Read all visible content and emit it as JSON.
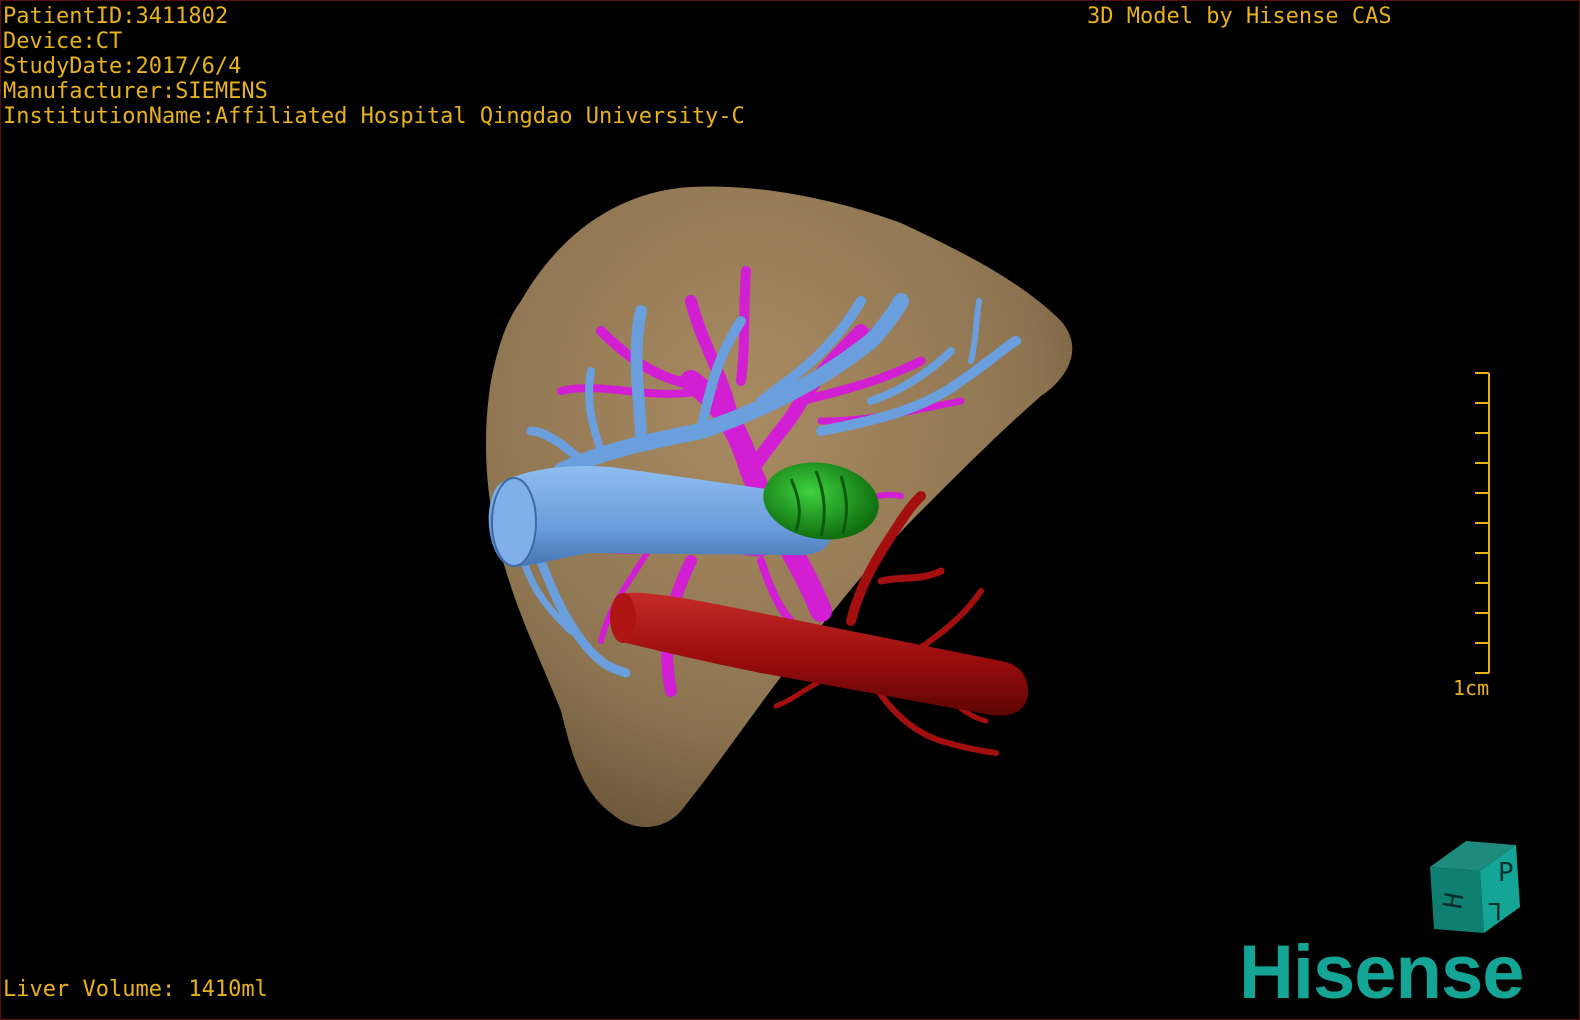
{
  "header": {
    "patient_id": "PatientID:3411802",
    "device": "Device:CT",
    "study_date": "StudyDate:2017/6/4",
    "manufacturer": "Manufacturer:SIEMENS",
    "institution": "InstitutionName:Affiliated Hospital Qingdao University-C"
  },
  "watermark": "3D Model by Hisense CAS",
  "footer": {
    "volume": "Liver Volume: 1410ml"
  },
  "scale": {
    "label": "1cm",
    "ticks": 10
  },
  "orientation_cube": {
    "faces": [
      "P",
      "H",
      "L"
    ]
  },
  "brand": {
    "name": "Hisense",
    "color": "#14a597"
  },
  "colors": {
    "overlay_text": "#e8b21c",
    "liver": "#8d7451",
    "hepatic_vein": "#6a9edc",
    "portal_vein": "#d21fd4",
    "artery_ivc": "#a30f0f",
    "lesion": "#1fa31f"
  }
}
